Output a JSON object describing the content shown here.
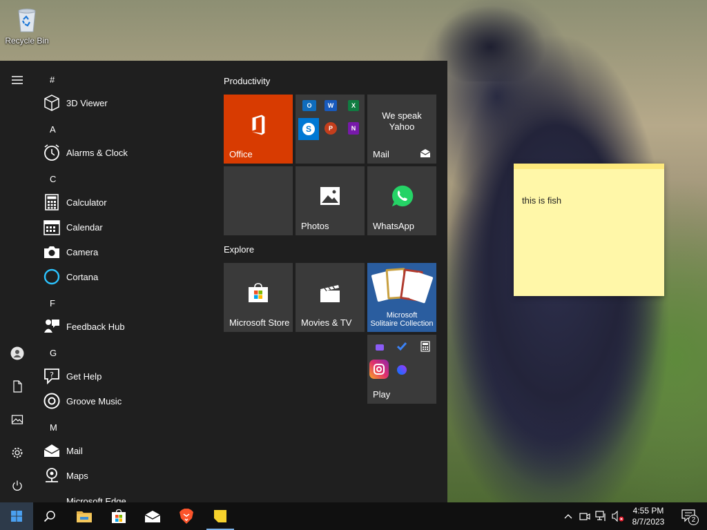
{
  "desktop": {
    "recycle_bin_label": "Recycle Bin",
    "sticky_note_text": "this is fish"
  },
  "start_menu": {
    "rail": [
      "hamburger-icon",
      "user-icon",
      "documents-icon",
      "pictures-icon",
      "settings-icon",
      "power-icon"
    ],
    "app_list": [
      {
        "type": "letter",
        "text": "#"
      },
      {
        "type": "app",
        "name": "3D Viewer",
        "icon": "cube-icon"
      },
      {
        "type": "letter",
        "text": "A"
      },
      {
        "type": "app",
        "name": "Alarms & Clock",
        "icon": "clock-icon"
      },
      {
        "type": "letter",
        "text": "C"
      },
      {
        "type": "app",
        "name": "Calculator",
        "icon": "calculator-icon"
      },
      {
        "type": "app",
        "name": "Calendar",
        "icon": "calendar-icon"
      },
      {
        "type": "app",
        "name": "Camera",
        "icon": "camera-icon"
      },
      {
        "type": "app",
        "name": "Cortana",
        "icon": "cortana-icon"
      },
      {
        "type": "letter",
        "text": "F"
      },
      {
        "type": "app",
        "name": "Feedback Hub",
        "icon": "feedback-icon"
      },
      {
        "type": "letter",
        "text": "G"
      },
      {
        "type": "app",
        "name": "Get Help",
        "icon": "help-icon"
      },
      {
        "type": "app",
        "name": "Groove Music",
        "icon": "music-icon"
      },
      {
        "type": "letter",
        "text": "M"
      },
      {
        "type": "app",
        "name": "Mail",
        "icon": "mail-icon"
      },
      {
        "type": "app",
        "name": "Maps",
        "icon": "maps-icon"
      },
      {
        "type": "app",
        "name": "Microsoft Edge",
        "icon": "edge-icon"
      }
    ],
    "groups": {
      "productivity": "Productivity",
      "explore": "Explore"
    },
    "tiles": {
      "office": "Office",
      "mail_line1": "We speak",
      "mail_line2": "Yahoo",
      "mail": "Mail",
      "photos": "Photos",
      "whatsapp": "WhatsApp",
      "store": "Microsoft Store",
      "movies": "Movies & TV",
      "solitaire_line1": "Microsoft",
      "solitaire_line2": "Solitaire Collection",
      "play": "Play"
    },
    "office_apps": [
      "O",
      "W",
      "X",
      "S",
      "P",
      "N"
    ]
  },
  "taskbar": {
    "time": "4:55 PM",
    "date": "8/7/2023",
    "notification_count": "2"
  },
  "colors": {
    "office_tile": "#d83b01",
    "solitaire_tile": "#2a5d9f",
    "start_bg": "#1f1f1f",
    "tile_bg": "#3a3a3a",
    "accent": "#7eb4ea"
  }
}
